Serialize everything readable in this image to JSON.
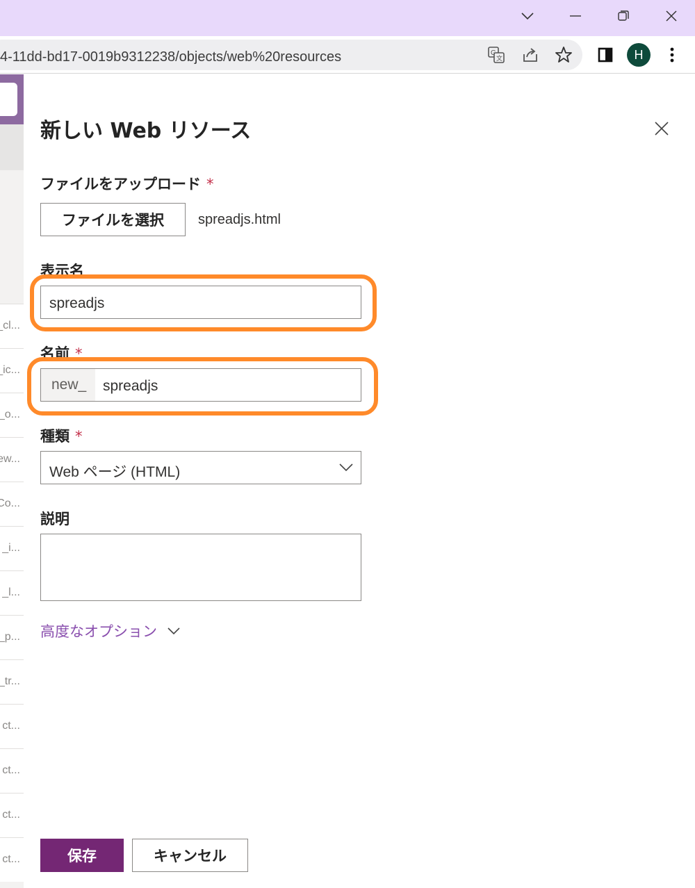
{
  "browser": {
    "url": "4-11dd-bd17-0019b9312238/objects/web%20resources",
    "avatar_initial": "H",
    "accent_color": "#e8d9fb"
  },
  "background_app": {
    "rows": [
      "_cl...",
      "_ic...",
      "_o...",
      "ew...",
      "Co...",
      "_i...",
      "_l...",
      "_p...",
      "_tr...",
      "ct...",
      "ct...",
      "ct...",
      "ct..."
    ]
  },
  "panel": {
    "title": "新しい Web リソース",
    "file_upload": {
      "label": "ファイルをアップロード",
      "required_mark": "*",
      "button_label": "ファイルを選択",
      "file_name": "spreadjs.html"
    },
    "display_name": {
      "label": "表示名",
      "value": "spreadjs"
    },
    "name": {
      "label": "名前",
      "required_mark": "*",
      "prefix": "new_",
      "value": "spreadjs"
    },
    "type": {
      "label": "種類",
      "required_mark": "*",
      "selected": "Web ページ (HTML)"
    },
    "description": {
      "label": "説明",
      "value": ""
    },
    "advanced_options_label": "高度なオプション",
    "save_label": "保存",
    "cancel_label": "キャンセル"
  },
  "colors": {
    "primary_button": "#742774",
    "highlight": "#ff8a2a",
    "link": "#8a4fae",
    "required": "#c4314b"
  }
}
